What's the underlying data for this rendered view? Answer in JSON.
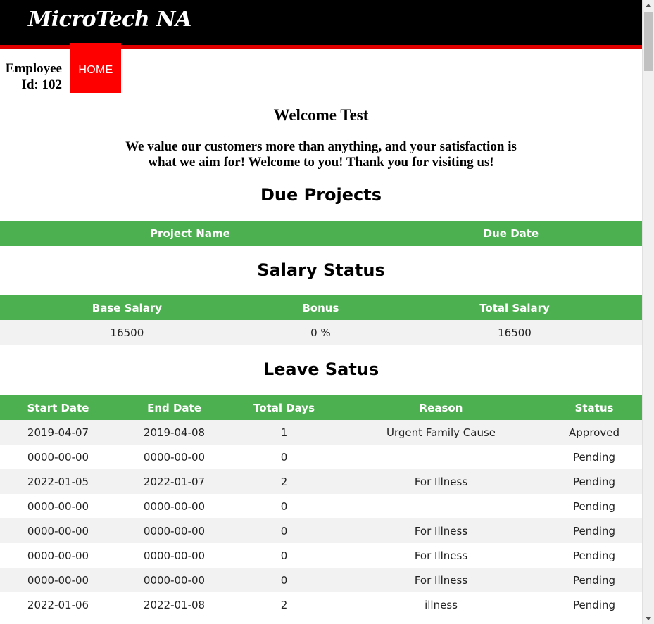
{
  "header": {
    "brand": "MicroTech NA"
  },
  "nav": {
    "home_label": "HOME"
  },
  "employee": {
    "line1": "Employee",
    "line2": "Id: 102"
  },
  "welcome": {
    "title": "Welcome Test",
    "message": "We value our customers more than anything, and your satisfaction is what we aim for! Welcome to you! Thank you for visiting us!"
  },
  "due_projects": {
    "heading": "Due Projects",
    "columns": [
      "Project Name",
      "Due Date"
    ],
    "rows": []
  },
  "salary": {
    "heading": "Salary Status",
    "columns": [
      "Base Salary",
      "Bonus",
      "Total Salary"
    ],
    "rows": [
      [
        "16500",
        "0 %",
        "16500"
      ]
    ]
  },
  "leave": {
    "heading": "Leave Satus",
    "columns": [
      "Start Date",
      "End Date",
      "Total Days",
      "Reason",
      "Status"
    ],
    "rows": [
      [
        "2019-04-07",
        "2019-04-08",
        "1",
        "Urgent Family Cause",
        "Approved"
      ],
      [
        "0000-00-00",
        "0000-00-00",
        "0",
        "",
        "Pending"
      ],
      [
        "2022-01-05",
        "2022-01-07",
        "2",
        "For Illness",
        "Pending"
      ],
      [
        "0000-00-00",
        "0000-00-00",
        "0",
        "",
        "Pending"
      ],
      [
        "0000-00-00",
        "0000-00-00",
        "0",
        "For Illness",
        "Pending"
      ],
      [
        "0000-00-00",
        "0000-00-00",
        "0",
        "For Illness",
        "Pending"
      ],
      [
        "0000-00-00",
        "0000-00-00",
        "0",
        "For Illness",
        "Pending"
      ],
      [
        "2022-01-06",
        "2022-01-08",
        "2",
        "illness",
        "Pending"
      ]
    ]
  },
  "colors": {
    "header_bg": "#000000",
    "accent_red": "#ff0000",
    "table_header": "#4caf50",
    "row_alt": "#f2f2f2"
  }
}
